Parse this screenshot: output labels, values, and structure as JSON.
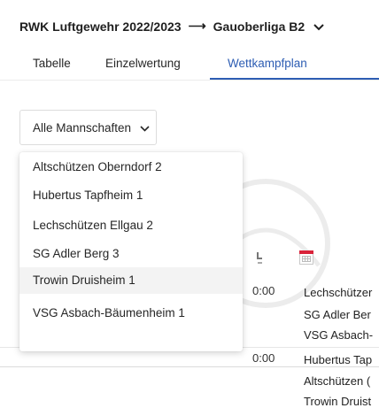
{
  "header": {
    "title": "RWK Luftgewehr 2022/2023",
    "arrow": "⟶",
    "league": "Gauoberliga B2",
    "chevron": "⌵"
  },
  "tabs": [
    {
      "label": "Tabelle",
      "active": false
    },
    {
      "label": "Einzelwertung",
      "active": false
    },
    {
      "label": "Wettkampfplan",
      "active": true
    }
  ],
  "filter": {
    "label": "Alle Mannschaften",
    "chevron": "⌵"
  },
  "menu": {
    "items": [
      {
        "label": "Altschützen Oberndorf 2",
        "selected": false
      },
      {
        "label": "Hubertus Tapfheim 1",
        "selected": false
      },
      {
        "label": "Lechschützen Ellgau 2",
        "selected": false
      },
      {
        "label": "SG Adler Berg 3",
        "selected": false
      },
      {
        "label": "Trowin Druisheim 1",
        "selected": true
      },
      {
        "label": "VSG Asbach-Bäumenheim 1",
        "selected": false
      }
    ]
  },
  "schedule": {
    "matches": [
      {
        "time": "0:00",
        "teams": [
          "Lechschützer",
          "SG Adler Ber",
          "VSG Asbach-"
        ]
      },
      {
        "time": "0:00",
        "teams": [
          "Hubertus Tap",
          "Altschützen (",
          "Trowin Druist"
        ]
      }
    ]
  },
  "colors": {
    "accent": "#2d5db3",
    "calendar_red": "#d9233a"
  }
}
